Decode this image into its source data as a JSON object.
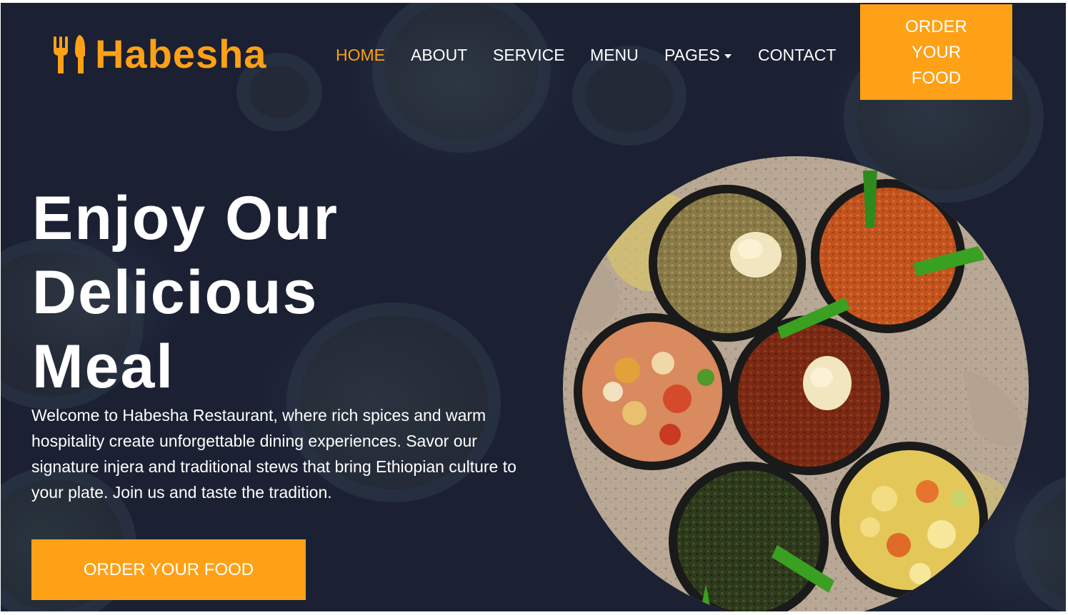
{
  "brand": {
    "name": "Habesha",
    "icon": "utensils-icon",
    "accent_color": "#fea116",
    "background_color": "#1b2033"
  },
  "nav": {
    "items": [
      {
        "label": "Home",
        "active": true
      },
      {
        "label": "About",
        "active": false
      },
      {
        "label": "Service",
        "active": false
      },
      {
        "label": "Menu",
        "active": false
      },
      {
        "label": "Pages",
        "active": false,
        "dropdown": true
      },
      {
        "label": "Contact",
        "active": false
      }
    ],
    "cta_label": "Order Your Food"
  },
  "hero": {
    "title": "Enjoy Our Delicious Meal",
    "description": "Welcome to Habesha Restaurant, where rich spices and warm hospitality create unforgettable dining experiences. Savor our signature injera and traditional stews that bring Ethiopian culture to your plate. Join us and taste the tradition.",
    "button_label": "Order Your Food",
    "image": "ethiopian-food-platter"
  }
}
